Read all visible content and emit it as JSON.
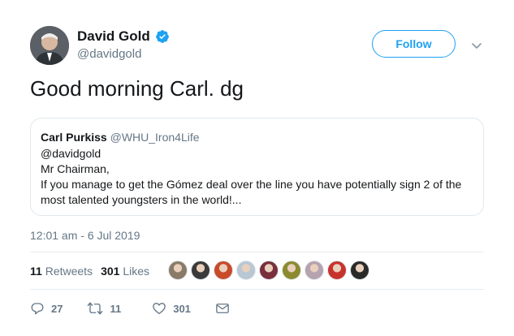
{
  "author": {
    "display_name": "David Gold",
    "handle": "@davidgold",
    "verified": true
  },
  "follow_label": "Follow",
  "tweet_text": "Good morning Carl. dg",
  "quote": {
    "name": "Carl Purkiss",
    "handle": "@WHU_Iron4Life",
    "lines": [
      "@davidgold",
      "Mr Chairman,",
      "If you manage to get the Gómez deal over the line you have potentially sign 2 of the",
      "most talented youngsters in the world!..."
    ]
  },
  "timestamp": "12:01 am - 6 Jul 2019",
  "stats": {
    "retweets_count": "11",
    "retweets_label": "Retweets",
    "likes_count": "301",
    "likes_label": "Likes"
  },
  "likers": [
    {
      "color": "#8a7a68"
    },
    {
      "color": "#3a3a3a"
    },
    {
      "color": "#c84b2a"
    },
    {
      "color": "#b9c7d4"
    },
    {
      "color": "#7a2f3d"
    },
    {
      "color": "#8c8a2e"
    },
    {
      "color": "#b7a2b0"
    },
    {
      "color": "#c8322d"
    },
    {
      "color": "#2b2a28"
    }
  ],
  "actions": {
    "reply_count": "27",
    "retweet_count": "11",
    "like_count": "301"
  },
  "colors": {
    "accent": "#1da1f2",
    "secondary_text": "#657786",
    "border": "#e1e8ed"
  },
  "icons": [
    "verified-badge-icon",
    "chevron-down-icon",
    "reply-icon",
    "retweet-icon",
    "like-icon",
    "message-icon"
  ]
}
